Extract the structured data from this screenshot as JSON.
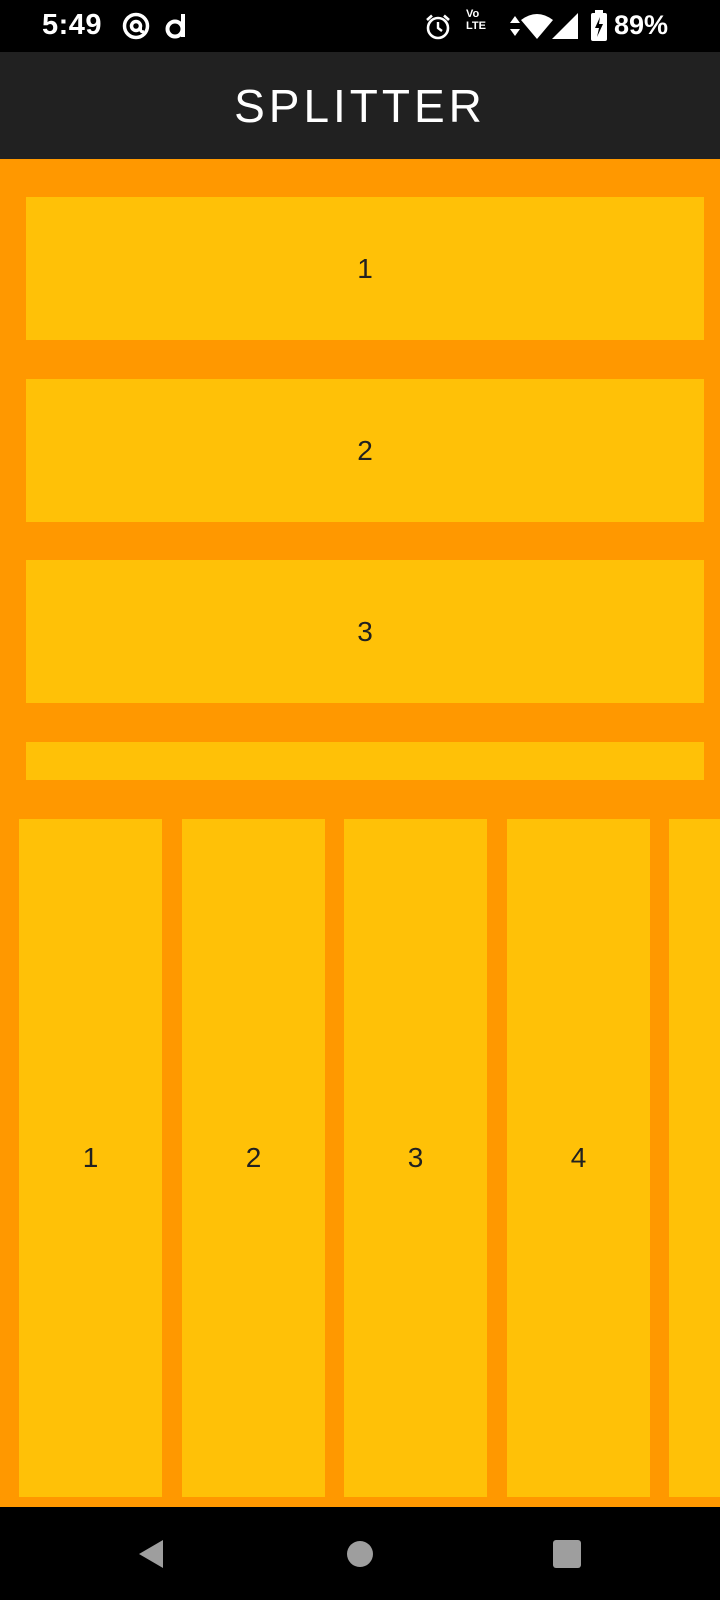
{
  "status_bar": {
    "time": "5:49",
    "battery_percent": "89%",
    "lte_line1": "Vo",
    "lte_line2": "LTE",
    "icons": [
      "at-sign-icon",
      "d-app-icon",
      "alarm-icon",
      "volte-icon",
      "data-arrows-icon",
      "wifi-icon",
      "signal-icon",
      "battery-charging-icon"
    ]
  },
  "app_bar": {
    "title": "SPLITTER"
  },
  "horizontal_splitter": {
    "panels": [
      {
        "label": "1"
      },
      {
        "label": "2"
      },
      {
        "label": "3"
      },
      {
        "label": ""
      }
    ]
  },
  "vertical_splitter": {
    "panels": [
      {
        "label": "1"
      },
      {
        "label": "2"
      },
      {
        "label": "3"
      },
      {
        "label": "4"
      },
      {
        "label": ""
      }
    ]
  },
  "nav_bar": {
    "icons": [
      "back-icon",
      "home-icon",
      "recents-icon"
    ]
  },
  "colors": {
    "background": "#FF9800",
    "panel": "#FFC107",
    "app_bar": "#212121",
    "status_bar": "#000000"
  }
}
